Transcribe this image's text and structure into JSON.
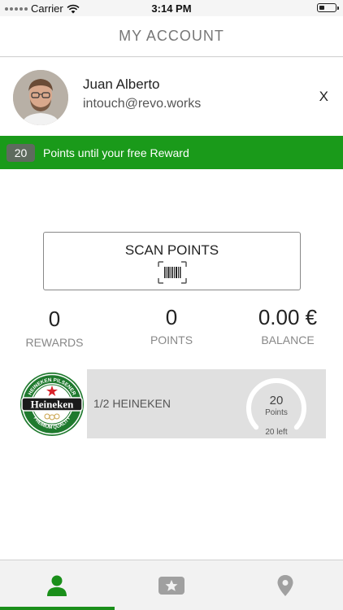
{
  "status": {
    "carrier": "Carrier",
    "time": "3:14 PM"
  },
  "nav": {
    "title": "MY ACCOUNT"
  },
  "profile": {
    "name": "Juan Alberto",
    "email": "intouch@revo.works",
    "close": "X"
  },
  "reward_bar": {
    "count": "20",
    "message": "Points until your free Reward"
  },
  "scan": {
    "label": "SCAN POINTS"
  },
  "stats": [
    {
      "value": "0",
      "label": "REWARDS"
    },
    {
      "value": "0",
      "label": "POINTS"
    },
    {
      "value": "0.00 €",
      "label": "BALANCE"
    }
  ],
  "reward_item": {
    "name": "1/2 HEINEKEN",
    "points": "20",
    "points_label": "Points",
    "left": "20 left",
    "progress": 0
  },
  "tabs": [
    {
      "icon": "person-icon",
      "active": true
    },
    {
      "icon": "star-icon",
      "active": false
    },
    {
      "icon": "location-pin-icon",
      "active": false
    }
  ],
  "colors": {
    "brand_green": "#1a9a1a",
    "badge_gray": "#5e6b5e",
    "panel_gray": "#e0e0e0",
    "tab_icon_gray": "#a0a0a0"
  }
}
